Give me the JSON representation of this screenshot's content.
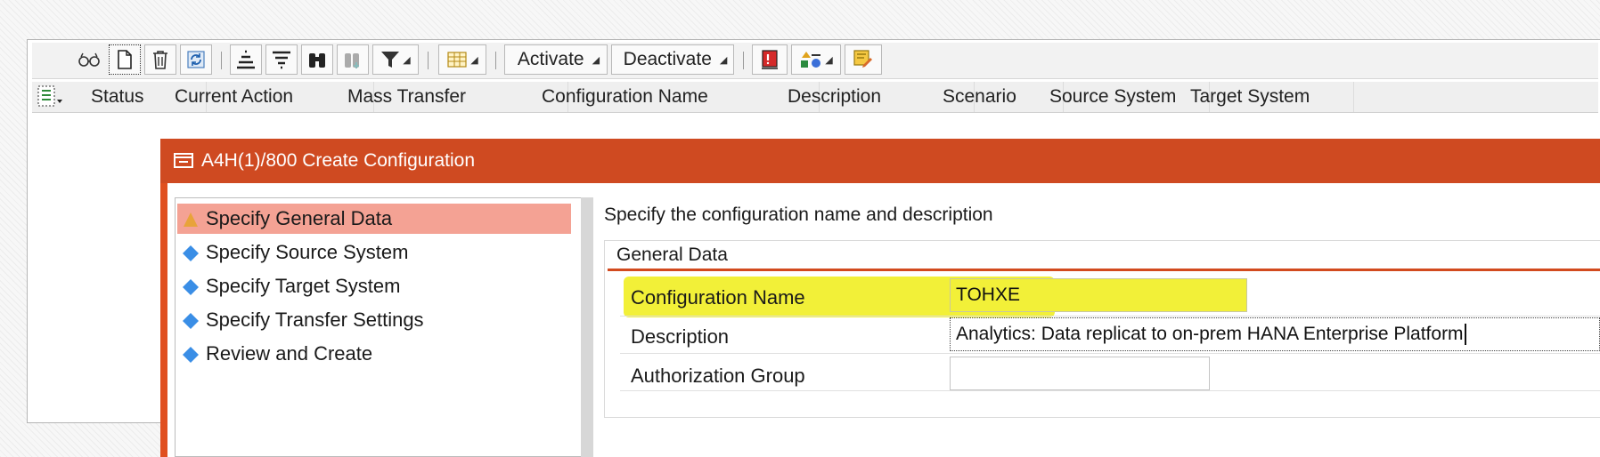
{
  "toolbar": {
    "activate_label": "Activate",
    "deactivate_label": "Deactivate",
    "icons": [
      "display-glasses-icon",
      "new-document-icon",
      "delete-trash-icon",
      "refresh-icon",
      "sort-ascending-icon",
      "sort-descending-icon",
      "find-binoculars-icon",
      "find-next-icon",
      "filter-icon",
      "layout-icon",
      "error-log-icon",
      "shapes-icon",
      "notes-icon"
    ]
  },
  "columns": [
    "Status",
    "Current Action",
    "Mass Transfer",
    "Configuration Name",
    "Description",
    "Scenario",
    "Source System",
    "Target System"
  ],
  "dialog": {
    "title": "A4H(1)/800 Create Configuration",
    "steps": [
      {
        "label": "Specify General Data",
        "icon": "warning-triangle-icon",
        "active": true
      },
      {
        "label": "Specify Source System",
        "icon": "diamond-icon",
        "active": false
      },
      {
        "label": "Specify Target System",
        "icon": "diamond-icon",
        "active": false
      },
      {
        "label": "Specify Transfer Settings",
        "icon": "diamond-icon",
        "active": false
      },
      {
        "label": "Review and Create",
        "icon": "diamond-icon",
        "active": false
      }
    ],
    "instruction": "Specify the configuration name and description",
    "group_title": "General Data",
    "fields": {
      "configuration_name": {
        "label": "Configuration Name",
        "value": "TOHXE"
      },
      "description": {
        "label": "Description",
        "value": "Analytics: Data replicat to on-prem HANA Enterprise Platform"
      },
      "authorization_group": {
        "label": "Authorization Group",
        "value": ""
      }
    }
  },
  "colors": {
    "title_bar": "#cf4a21",
    "active_step": "#f4a294",
    "highlight": "#f2f038",
    "step_diamond": "#3a8ee6",
    "step_warning": "#e8a33a"
  }
}
